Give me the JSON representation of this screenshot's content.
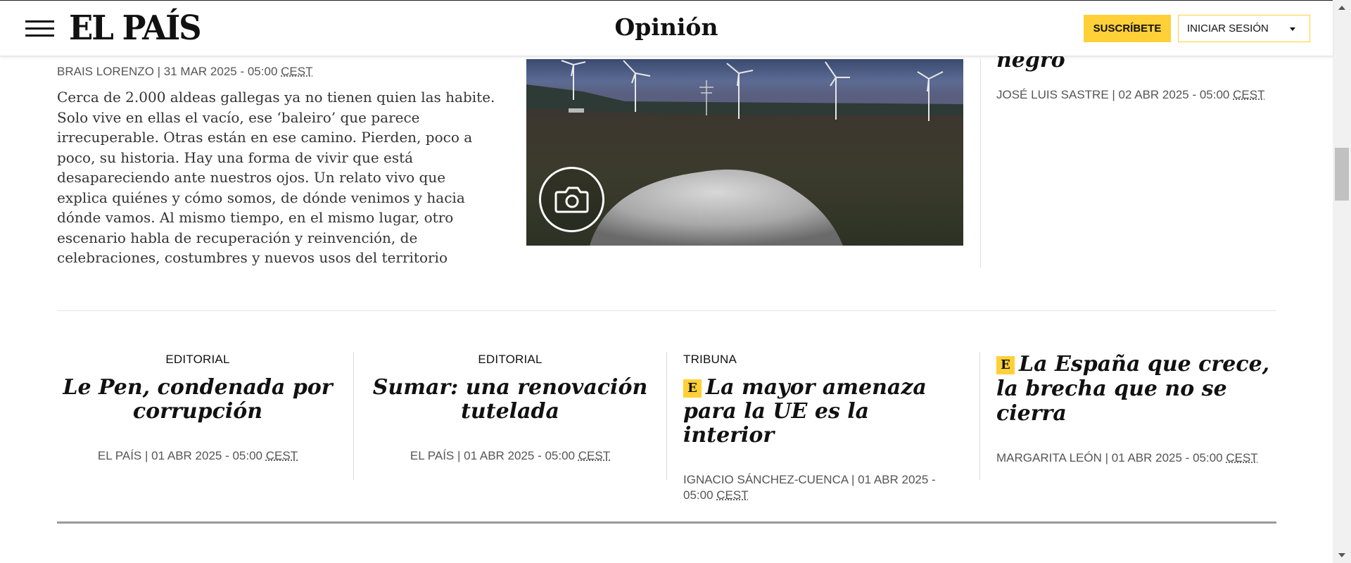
{
  "header": {
    "logo": "EL PAÍS",
    "section": "Opinión",
    "subscribe_label": "SUSCRÍBETE",
    "login_label": "INICIAR SESIÓN"
  },
  "top_row": {
    "left_byline_author": "BRAIS LORENZO",
    "left_byline_date": "31 MAR 2025 - 05:00",
    "left_byline_tz": "CEST",
    "lead_text": "Cerca de 2.000 aldeas gallegas ya no tienen quien las habite. Solo vive en ellas el vacío, ese ‘baleiro’ que parece irrecuperable. Otras están en ese camino. Pierden, poco a poco, su historia. Hay una forma de vivir que está desapareciendo ante nuestros ojos. Un relato vivo que explica quiénes y cómo somos, de dónde venimos y hacia dónde vamos. Al mismo tiempo, en el mismo lugar, otro escenario habla de recuperación y reinvención, de celebraciones, costumbres y nuevos usos del territorio",
    "right_headline": "negro",
    "right_byline_author": "JOSÉ LUIS SASTRE",
    "right_byline_date": "02 ABR 2025 - 05:00",
    "right_byline_tz": "CEST"
  },
  "articles": [
    {
      "kicker": "EDITORIAL",
      "headline": "Le Pen, condenada por corrupción",
      "author": "EL PAÍS",
      "date": "01 ABR 2025 - 05:00",
      "tz": "CEST"
    },
    {
      "kicker": "EDITORIAL",
      "headline": "Sumar: una renovación tutelada",
      "author": "EL PAÍS",
      "date": "01 ABR 2025 - 05:00",
      "tz": "CEST"
    },
    {
      "kicker": "TRIBUNA",
      "badge": "E",
      "headline": "La mayor amenaza para la UE es la interior",
      "author": "IGNACIO SÁNCHEZ-CUENCA",
      "date": "01 ABR 2025 - 05:00",
      "tz": "CEST"
    },
    {
      "badge": "E",
      "headline": "La España que crece, la brecha que no se cierra",
      "author": "MARGARITA LEÓN",
      "date": "01 ABR 2025 - 05:00",
      "tz": "CEST"
    }
  ],
  "colors": {
    "accent": "#ffd037",
    "text": "#111111",
    "meta": "#555555"
  }
}
